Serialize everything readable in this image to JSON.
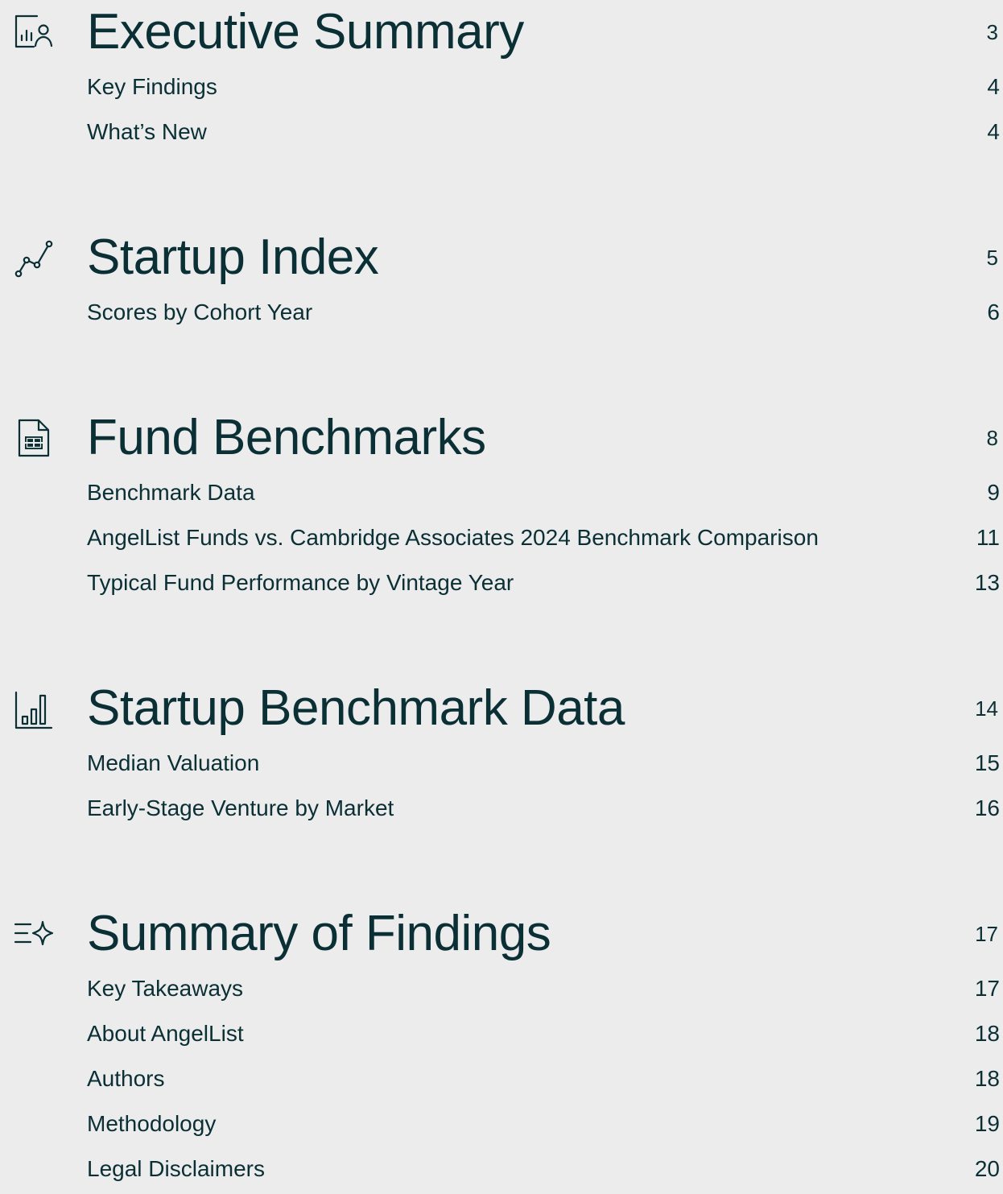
{
  "sections": [
    {
      "icon": "chart-person-icon",
      "title": "Executive Summary",
      "page": "3",
      "entries": [
        {
          "label": "Key Findings",
          "page": "4"
        },
        {
          "label": "What’s New",
          "page": "4"
        }
      ]
    },
    {
      "icon": "line-graph-icon",
      "title": "Startup Index",
      "page": "5",
      "entries": [
        {
          "label": "Scores by Cohort Year",
          "page": "6"
        }
      ]
    },
    {
      "icon": "spreadsheet-document-icon",
      "title": "Fund Benchmarks",
      "page": "8",
      "entries": [
        {
          "label": "Benchmark Data",
          "page": "9"
        },
        {
          "label": "AngelList Funds vs. Cambridge Associates 2024 Benchmark Comparison",
          "page": "11"
        },
        {
          "label": "Typical Fund Performance by Vintage Year",
          "page": "13"
        }
      ]
    },
    {
      "icon": "bar-chart-icon",
      "title": "Startup Benchmark Data",
      "page": "14",
      "entries": [
        {
          "label": "Median Valuation",
          "page": "15"
        },
        {
          "label": "Early-Stage Venture by Market",
          "page": "16"
        }
      ]
    },
    {
      "icon": "list-sparkle-icon",
      "title": "Summary of Findings",
      "page": "17",
      "entries": [
        {
          "label": "Key Takeaways",
          "page": "17"
        },
        {
          "label": "About AngelList",
          "page": "18"
        },
        {
          "label": "Authors",
          "page": "18"
        },
        {
          "label": "Methodology",
          "page": "19"
        },
        {
          "label": "Legal Disclaimers",
          "page": "20"
        }
      ]
    }
  ]
}
